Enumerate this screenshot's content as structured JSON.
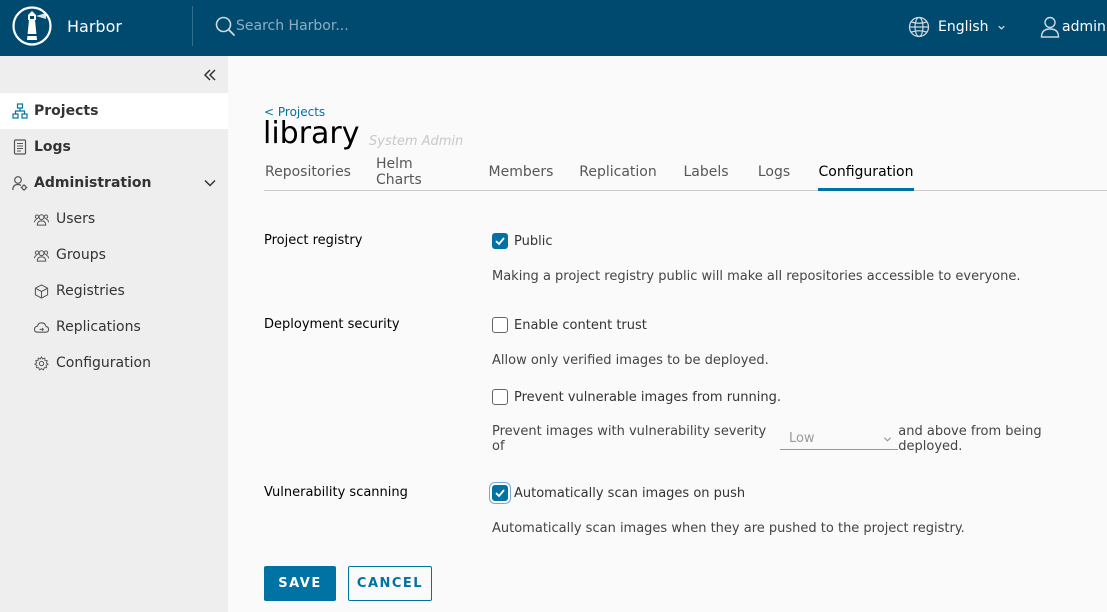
{
  "header": {
    "brand": "Harbor",
    "search_placeholder": "Search Harbor...",
    "language": "English",
    "user": "admin"
  },
  "sidebar": {
    "items": [
      {
        "label": "Projects",
        "icon": "projects-icon",
        "active": true
      },
      {
        "label": "Logs",
        "icon": "logs-icon"
      },
      {
        "label": "Administration",
        "icon": "administration-icon",
        "expanded": true
      }
    ],
    "admin_items": [
      {
        "label": "Users",
        "icon": "users-icon"
      },
      {
        "label": "Groups",
        "icon": "groups-icon"
      },
      {
        "label": "Registries",
        "icon": "registries-icon"
      },
      {
        "label": "Replications",
        "icon": "replications-icon"
      },
      {
        "label": "Configuration",
        "icon": "configuration-icon"
      }
    ]
  },
  "main": {
    "back_link": "< Projects",
    "project_name": "library",
    "role": "System Admin",
    "tabs": [
      {
        "label": "Repositories"
      },
      {
        "label": "Helm Charts"
      },
      {
        "label": "Members"
      },
      {
        "label": "Replication"
      },
      {
        "label": "Labels"
      },
      {
        "label": "Logs"
      },
      {
        "label": "Configuration",
        "active": true
      }
    ],
    "config": {
      "project_registry_label": "Project registry",
      "public_label": "Public",
      "public_checked": true,
      "public_hint": "Making a project registry public will make all repositories accessible to everyone.",
      "deployment_security_label": "Deployment security",
      "content_trust_label": "Enable content trust",
      "content_trust_checked": false,
      "content_trust_hint": "Allow only verified images to be deployed.",
      "prevent_vuln_label": "Prevent vulnerable images from running.",
      "prevent_vuln_checked": false,
      "severity_prefix": "Prevent images with vulnerability severity of",
      "severity_value": "Low",
      "severity_suffix": "and above from being deployed.",
      "vuln_scanning_label": "Vulnerability scanning",
      "auto_scan_label": "Automatically scan images on push",
      "auto_scan_checked": true,
      "auto_scan_hint": "Automatically scan images when they are pushed to the project registry."
    },
    "buttons": {
      "save": "SAVE",
      "cancel": "CANCEL"
    }
  },
  "colors": {
    "header_bg": "#004a70",
    "accent": "#0072a3",
    "sidebar_bg": "#eeeeee"
  }
}
